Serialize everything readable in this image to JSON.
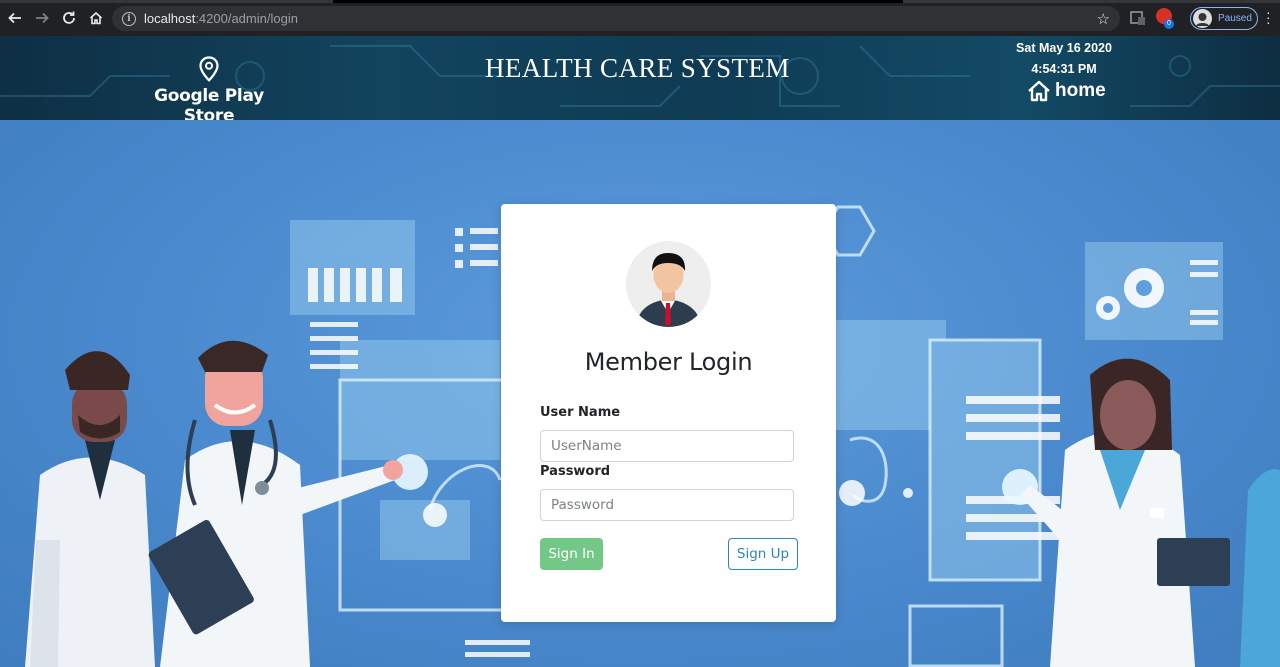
{
  "browser": {
    "url_host": "localhost",
    "url_path": ":4200/admin/login",
    "profile_status": "Paused",
    "extension_badge": "0"
  },
  "header": {
    "store_label": "Google Play Store",
    "title": "HEALTH CARE SYSTEM",
    "date": "Sat May 16 2020",
    "time": "4:54:31 PM",
    "home_label": "home"
  },
  "login": {
    "title": "Member Login",
    "username_label": "User Name",
    "username_placeholder": "UserName",
    "username_value": "",
    "password_label": "Password",
    "password_placeholder": "Password",
    "password_value": "",
    "signin_label": "Sign In",
    "signup_label": "Sign Up"
  },
  "colors": {
    "signin_button": "#74c887",
    "signup_button_border": "#2c89b5",
    "background": "#4a89cd",
    "header": "#12445e"
  }
}
